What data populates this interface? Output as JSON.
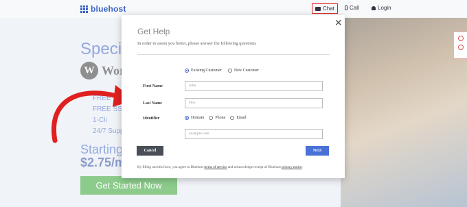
{
  "header": {
    "logo_text": "bluehost",
    "chat": "Chat",
    "call": "Call",
    "login": "Login"
  },
  "hero": {
    "headline": "Specia",
    "wp_text": "Wor",
    "features": [
      "FREE",
      "FREE SSL",
      "1-Cli",
      "24/7 Supp"
    ],
    "starting": "Starting a",
    "price": "$2.75/m",
    "cta": "Get Started Now"
  },
  "modal": {
    "title": "Get Help",
    "subtitle": "In order to assist you better, please answer the following questions",
    "customer_options": [
      "Existing Customer",
      "New Customer"
    ],
    "customer_selected": "Existing Customer",
    "first_name_label": "First Name",
    "first_name_placeholder": "John",
    "last_name_label": "Last Name",
    "last_name_placeholder": "Doe",
    "identifier_label": "Identifier",
    "identifier_options": [
      "Domain",
      "Phone",
      "Email"
    ],
    "identifier_selected": "Domain",
    "identifier_placeholder": "example.com",
    "cancel": "Cancel",
    "next": "Next",
    "footer_pre": "By filling out this form, you agree to Bluehost",
    "footer_tos": "terms of service",
    "footer_mid": "and acknowledge receipt of Bluehost",
    "footer_privacy": "privacy notice",
    "footer_end": "."
  },
  "colors": {
    "brand_blue": "#3b62c6",
    "cta_green": "#2fa02c",
    "annotation_red": "#e02020",
    "next_blue": "#4a72d6"
  }
}
